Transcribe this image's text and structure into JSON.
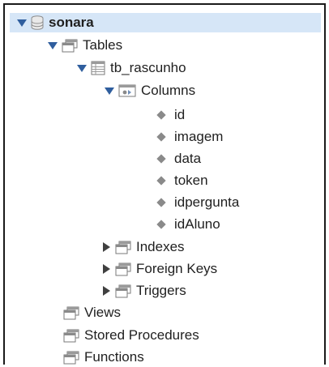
{
  "tree": {
    "schema": {
      "label": "sonara",
      "icon": "database-icon"
    },
    "tables": {
      "label": "Tables",
      "icon": "folder-icon"
    },
    "table": {
      "label": "tb_rascunho",
      "icon": "table-icon"
    },
    "columns": {
      "label": "Columns",
      "icon": "columns-icon",
      "items": [
        "id",
        "imagem",
        "data",
        "token",
        "idpergunta",
        "idAluno"
      ]
    },
    "indexes": {
      "label": "Indexes",
      "icon": "folder-icon"
    },
    "foreign_keys": {
      "label": "Foreign Keys",
      "icon": "folder-icon"
    },
    "triggers": {
      "label": "Triggers",
      "icon": "folder-icon"
    },
    "views": {
      "label": "Views",
      "icon": "folder-icon"
    },
    "stored_procedures": {
      "label": "Stored Procedures",
      "icon": "folder-icon"
    },
    "functions": {
      "label": "Functions",
      "icon": "folder-icon"
    }
  },
  "colors": {
    "selection": "#d6e6f7",
    "expander_open": "#2f5e9e",
    "column_bullet": "#8a8a8a"
  }
}
